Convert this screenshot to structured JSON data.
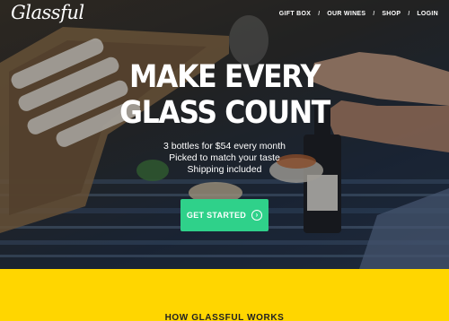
{
  "nav": {
    "logo": "Glassful",
    "items": [
      {
        "label": "GIFT BOX"
      },
      {
        "label": "OUR WINES"
      },
      {
        "label": "SHOP"
      },
      {
        "label": "LOGIN"
      }
    ],
    "separator": "/"
  },
  "hero": {
    "headline_line1": "MAKE EVERY",
    "headline_line2": "GLASS COUNT",
    "sub_line1": "3 bottles for $54 every month",
    "sub_line2": "Picked to match your taste",
    "sub_line3": "Shipping included",
    "cta_label": "GET STARTED"
  },
  "section": {
    "title": "HOW GLASSFUL WORKS"
  },
  "colors": {
    "accent": "#2fd18a",
    "band": "#ffd600"
  }
}
